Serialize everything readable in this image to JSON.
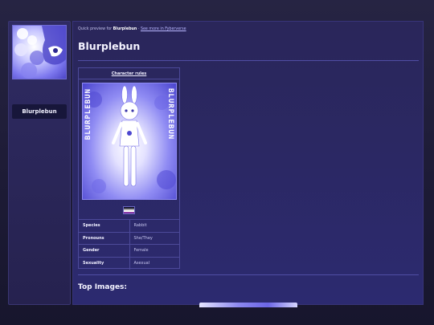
{
  "profile": {
    "name": "Blurplebun"
  },
  "breadcrumb": {
    "prefix": "Quick preview for",
    "name": "Blurplebun",
    "separator": "·",
    "link": "See more in Fyberverse"
  },
  "page": {
    "title": "Blurplebun"
  },
  "card": {
    "header_link": "Character rules",
    "ref_text_left": "BLURPLEBUN",
    "ref_text_right": "BLURPLEBUN",
    "flag_name": "asexual-flag",
    "rows": [
      {
        "key": "Species",
        "value": "Rabbit"
      },
      {
        "key": "Pronouns",
        "value": "She/They"
      },
      {
        "key": "Gender",
        "value": "Female"
      },
      {
        "key": "Sexuality",
        "value": "Asexual"
      }
    ]
  },
  "sections": {
    "top_images": "Top Images:"
  },
  "colors": {
    "accent": "#b8b6ff",
    "panel": "#2b2863",
    "border": "#4d4a9a"
  }
}
